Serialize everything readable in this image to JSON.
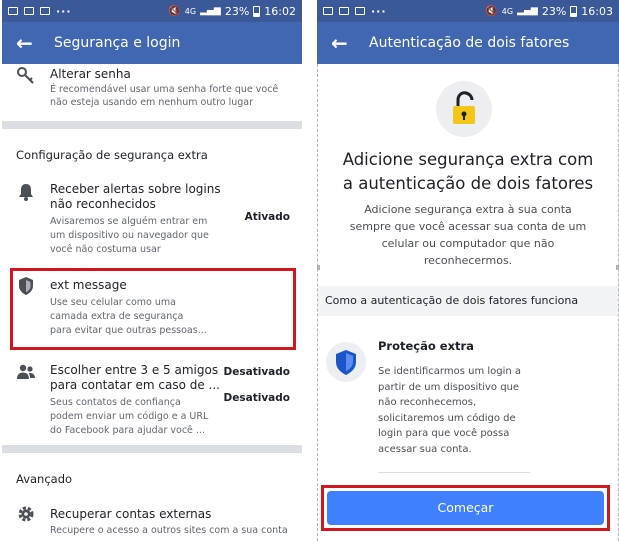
{
  "left": {
    "status": {
      "battery": "23%",
      "time": "16:02",
      "net": "4G"
    },
    "appbar": {
      "title": "Segurança e login"
    },
    "change_password": {
      "title": "Alterar senha",
      "subtitle_lines": [
        "É recomendável usar uma senha forte que você",
        "não esteja usando em nenhum outro lugar"
      ]
    },
    "section_extra": "Configuração de segurança extra",
    "alerts": {
      "title_lines": [
        "Receber alertas sobre logins",
        "não reconhecidos"
      ],
      "subtitle_lines": [
        "Avisaremos se alguém entrar em",
        "um dispositivo ou navegador que",
        "você não costuma usar"
      ],
      "status": "Ativado"
    },
    "text_message": {
      "title": "ext message",
      "subtitle_lines": [
        "Use seu celular como uma",
        "camada extra de segurança",
        "para evitar que outras pessoas..."
      ],
      "status": "Desativado"
    },
    "friends": {
      "title_lines": [
        "Escolher entre 3 e 5 amigos",
        "para contatar em caso de ..."
      ],
      "subtitle_lines": [
        "Seus contatos de confiança",
        "podem enviar um código e a URL",
        "do Facebook para ajudar você ..."
      ],
      "status": "Desativado"
    },
    "section_advanced": "Avançado",
    "external": {
      "title": "Recuperar contas externas",
      "subtitle": "Recupere o acesso a outros sites com a sua conta"
    }
  },
  "right": {
    "status": {
      "battery": "23%",
      "time": "16:03",
      "net": "4G"
    },
    "appbar": {
      "title": "Autenticação de dois fatores"
    },
    "headline_lines": [
      "Adicione segurança extra com",
      "a autenticação de dois fatores"
    ],
    "desc_lines": [
      "Adicione segurança extra à sua conta",
      "sempre que você acessar sua conta de um",
      "celular ou computador que não",
      "reconhecermos."
    ],
    "how_it_works": "Como a autenticação de dois fatores funciona",
    "feature": {
      "title": "Proteção extra",
      "desc_lines": [
        "Se identificarmos um login a",
        "partir de um dispositivo que",
        "não reconhecemos,",
        "solicitaremos um código de",
        "login para que você possa",
        "acessar sua conta."
      ]
    },
    "cta": "Começar"
  },
  "colors": {
    "status_bar": "#3b5998",
    "app_bar": "#4267b2",
    "cta": "#4080ff",
    "highlight": "#d0161f",
    "shield": "#1a56c8",
    "lock": "#f5c518"
  }
}
